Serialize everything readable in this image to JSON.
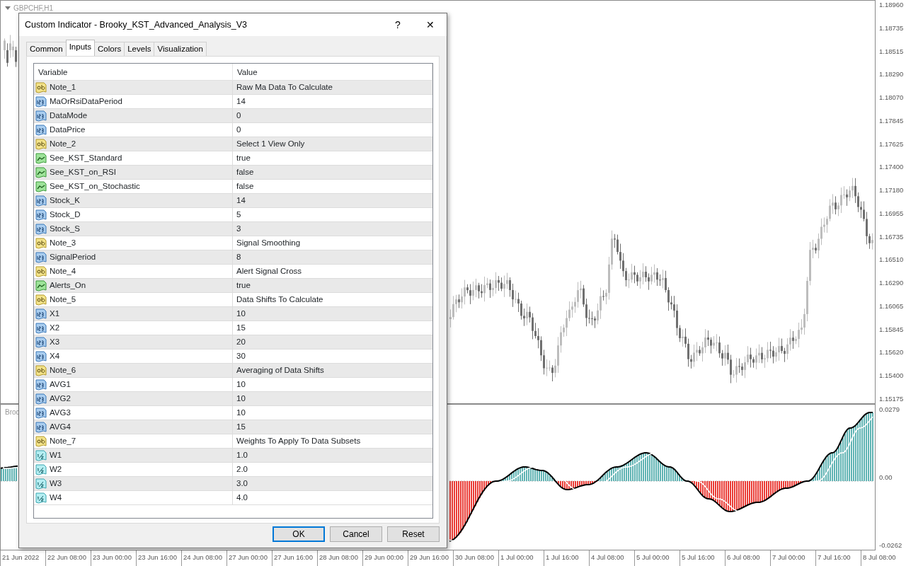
{
  "chart": {
    "symbol_label": "GBPCHF,H1",
    "indicator_label": "Broo",
    "price_axis": [
      "1.18960",
      "1.18735",
      "1.18515",
      "1.18290",
      "1.18070",
      "1.17845",
      "1.17625",
      "1.17400",
      "1.17180",
      "1.16955",
      "1.16735",
      "1.16510",
      "1.16290",
      "1.16065",
      "1.15845",
      "1.15620",
      "1.15400",
      "1.15175"
    ],
    "indicator_axis": [
      "0.0279",
      "0.00",
      "-0.0262"
    ],
    "time_axis": [
      "21 Jun 2022",
      "22 Jun 08:00",
      "23 Jun 00:00",
      "23 Jun 16:00",
      "24 Jun 08:00",
      "27 Jun 00:00",
      "27 Jun 16:00",
      "28 Jun 08:00",
      "29 Jun 00:00",
      "29 Jun 16:00",
      "30 Jun 08:00",
      "1 Jul 00:00",
      "1 Jul 16:00",
      "4 Jul 08:00",
      "5 Jul 00:00",
      "5 Jul 16:00",
      "6 Jul 08:00",
      "7 Jul 00:00",
      "7 Jul 16:00",
      "8 Jul 08:00"
    ]
  },
  "dialog": {
    "title": "Custom Indicator - Brooky_KST_Advanced_Analysis_V3",
    "help_button": "?",
    "close_button": "✕",
    "tabs": [
      {
        "label": "Common",
        "selected": false
      },
      {
        "label": "Inputs",
        "selected": true
      },
      {
        "label": "Colors",
        "selected": false
      },
      {
        "label": "Levels",
        "selected": false
      },
      {
        "label": "Visualization",
        "selected": false
      }
    ],
    "table": {
      "columns": [
        "Variable",
        "Value"
      ],
      "rows": [
        {
          "kind": "string",
          "variable": "Note_1",
          "value": "Raw Ma Data To Calculate"
        },
        {
          "kind": "int",
          "variable": "MaOrRsiDataPeriod",
          "value": "14"
        },
        {
          "kind": "int",
          "variable": "DataMode",
          "value": "0"
        },
        {
          "kind": "int",
          "variable": "DataPrice",
          "value": "0"
        },
        {
          "kind": "string",
          "variable": "Note_2",
          "value": "Select 1 View Only"
        },
        {
          "kind": "bool",
          "variable": "See_KST_Standard",
          "value": "true"
        },
        {
          "kind": "bool",
          "variable": "See_KST_on_RSI",
          "value": "false"
        },
        {
          "kind": "bool",
          "variable": "See_KST_on_Stochastic",
          "value": "false"
        },
        {
          "kind": "int",
          "variable": "Stock_K",
          "value": "14"
        },
        {
          "kind": "int",
          "variable": "Stock_D",
          "value": "5"
        },
        {
          "kind": "int",
          "variable": "Stock_S",
          "value": "3"
        },
        {
          "kind": "string",
          "variable": "Note_3",
          "value": "Signal Smoothing"
        },
        {
          "kind": "int",
          "variable": "SignalPeriod",
          "value": "8"
        },
        {
          "kind": "string",
          "variable": "Note_4",
          "value": "Alert Signal Cross"
        },
        {
          "kind": "bool",
          "variable": "Alerts_On",
          "value": "true"
        },
        {
          "kind": "string",
          "variable": "Note_5",
          "value": "Data Shifts To Calculate"
        },
        {
          "kind": "int",
          "variable": "X1",
          "value": "10"
        },
        {
          "kind": "int",
          "variable": "X2",
          "value": "15"
        },
        {
          "kind": "int",
          "variable": "X3",
          "value": "20"
        },
        {
          "kind": "int",
          "variable": "X4",
          "value": "30"
        },
        {
          "kind": "string",
          "variable": "Note_6",
          "value": "Averaging of Data Shifts"
        },
        {
          "kind": "int",
          "variable": "AVG1",
          "value": "10"
        },
        {
          "kind": "int",
          "variable": "AVG2",
          "value": "10"
        },
        {
          "kind": "int",
          "variable": "AVG3",
          "value": "10"
        },
        {
          "kind": "int",
          "variable": "AVG4",
          "value": "15"
        },
        {
          "kind": "string",
          "variable": "Note_7",
          "value": "Weights To Apply To Data Subsets"
        },
        {
          "kind": "double",
          "variable": "W1",
          "value": "1.0"
        },
        {
          "kind": "double",
          "variable": "W2",
          "value": "2.0"
        },
        {
          "kind": "double",
          "variable": "W3",
          "value": "3.0"
        },
        {
          "kind": "double",
          "variable": "W4",
          "value": "4.0"
        }
      ]
    },
    "buttons": [
      {
        "label": "OK",
        "focused": true
      },
      {
        "label": "Cancel",
        "focused": false
      },
      {
        "label": "Reset",
        "focused": false
      }
    ]
  }
}
